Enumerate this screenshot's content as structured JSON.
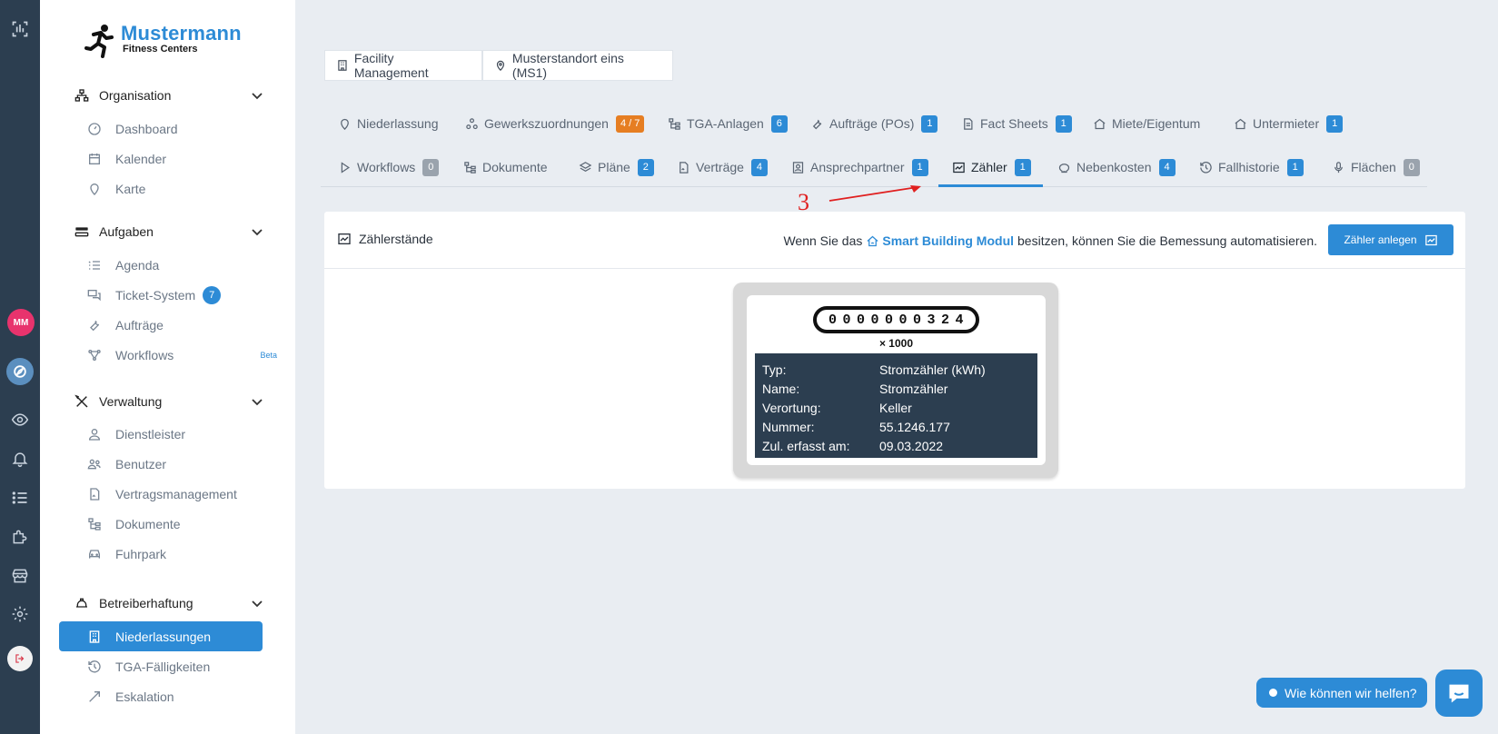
{
  "brand": {
    "line1": "Mustermann",
    "line2": "Fitness Centers"
  },
  "rail": {
    "avatar": "MM"
  },
  "sidebar": {
    "sections": [
      {
        "label": "Organisation",
        "items": [
          "Dashboard",
          "Kalender",
          "Karte"
        ]
      },
      {
        "label": "Aufgaben",
        "items": [
          "Agenda",
          "Ticket-System",
          "Aufträge",
          "Workflows"
        ],
        "ticket_count": "7",
        "beta": "Beta"
      },
      {
        "label": "Verwaltung",
        "items": [
          "Dienstleister",
          "Benutzer",
          "Vertragsmanagement",
          "Dokumente",
          "Fuhrpark"
        ]
      },
      {
        "label": "Betreiberhaftung",
        "items": [
          "Niederlassungen",
          "TGA-Fälligkeiten",
          "Eskalation"
        ]
      }
    ]
  },
  "breadcrumb": {
    "first": "Facility Management",
    "second": "Musterstandort eins (MS1)"
  },
  "tabs_row1": [
    {
      "label": "Niederlassung",
      "badge": ""
    },
    {
      "label": "Gewerkszuordnungen",
      "badge": "4 / 7"
    },
    {
      "label": "TGA-Anlagen",
      "badge": "6"
    },
    {
      "label": "Aufträge (POs)",
      "badge": "1"
    },
    {
      "label": "Fact Sheets",
      "badge": "1"
    },
    {
      "label": "Miete/Eigentum",
      "badge": ""
    },
    {
      "label": "Untermieter",
      "badge": "1"
    }
  ],
  "tabs_row2": [
    {
      "label": "Workflows",
      "badge": "0"
    },
    {
      "label": "Dokumente",
      "badge": ""
    },
    {
      "label": "Pläne",
      "badge": "2"
    },
    {
      "label": "Verträge",
      "badge": "4"
    },
    {
      "label": "Ansprechpartner",
      "badge": "1"
    },
    {
      "label": "Zähler",
      "badge": "1"
    },
    {
      "label": "Nebenkosten",
      "badge": "4"
    },
    {
      "label": "Fallhistorie",
      "badge": "1"
    },
    {
      "label": "Flächen",
      "badge": "0"
    }
  ],
  "annotation": {
    "number": "3"
  },
  "panel": {
    "title": "Zählerstände",
    "info_before": "Wenn Sie das",
    "info_link": "Smart Building Modul",
    "info_after": "besitzen, können Sie die Bemessung automatisieren.",
    "button": "Zähler anlegen"
  },
  "meter": {
    "reading": "0000000324",
    "multiplier": "× 1000",
    "rows": [
      {
        "k": "Typ:",
        "v": "Stromzähler (kWh)"
      },
      {
        "k": "Name:",
        "v": "Stromzähler"
      },
      {
        "k": "Verortung:",
        "v": "Keller"
      },
      {
        "k": "Nummer:",
        "v": "55.1246.177"
      },
      {
        "k": "Zul. erfasst am:",
        "v": "09.03.2022"
      }
    ]
  },
  "chat": {
    "label": "Wie können wir helfen?"
  },
  "colors": {
    "accent": "#2d8bd6",
    "rail": "#2c3e50",
    "orange": "#e67e22",
    "annotation": "#e02020"
  }
}
